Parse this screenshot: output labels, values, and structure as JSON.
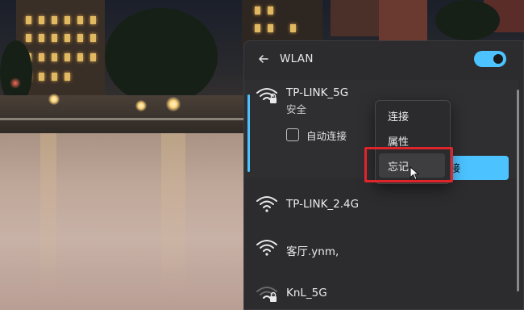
{
  "flyout": {
    "title": "WLAN",
    "toggle_on": true
  },
  "networks": [
    {
      "name": "TP-LINK_5G",
      "status": "安全",
      "secured": true,
      "expanded": true,
      "auto_connect_label": "自动连接",
      "auto_connect_checked": false,
      "connect_button_label_visible": "接"
    },
    {
      "name": "TP-LINK_2.4G",
      "secured": false
    },
    {
      "name": "客厅.ynm,",
      "secured": false
    },
    {
      "name": "KnL_5G",
      "secured": true
    }
  ],
  "context_menu": {
    "items": [
      "连接",
      "属性",
      "忘记"
    ],
    "hovered": "忘记"
  },
  "colors": {
    "accent": "#4cc2ff",
    "panel": "#2c2c2e",
    "highlight": "#e0242b"
  }
}
